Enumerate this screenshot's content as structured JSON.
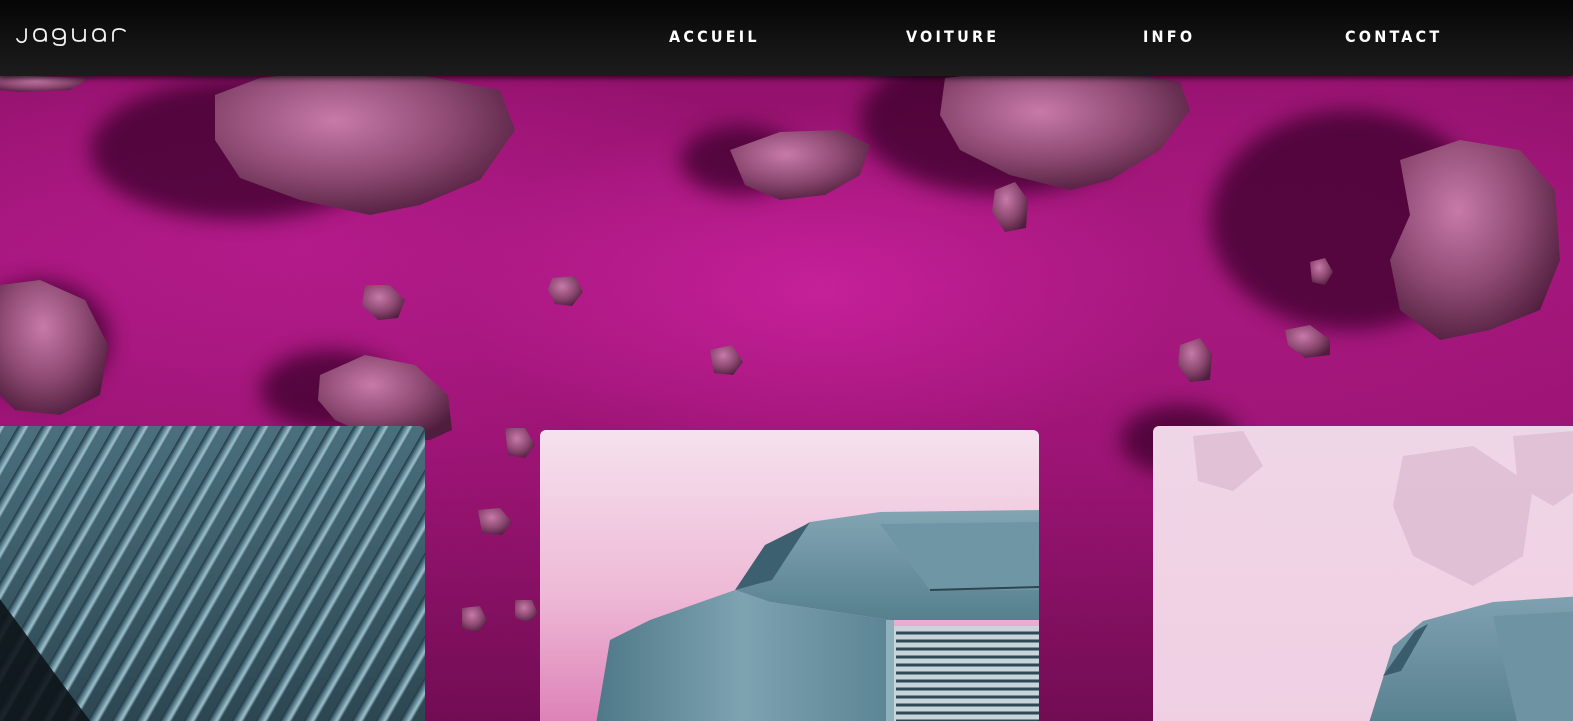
{
  "brand": {
    "logo_text": "JAGUAR"
  },
  "nav": {
    "items": [
      {
        "label": "ACCUEIL"
      },
      {
        "label": "VOITURE"
      },
      {
        "label": "INFO"
      },
      {
        "label": "CONTACT"
      }
    ]
  },
  "hero": {
    "background_color": "#a3157a",
    "image": "pink-rocky-desert"
  },
  "cards": [
    {
      "image": "car-grille-closeup-teal"
    },
    {
      "image": "teal-concept-car-front-pink-backdrop"
    },
    {
      "image": "teal-concept-car-front-pink-backdrop-faded"
    }
  ],
  "colors": {
    "navbar": "#121212",
    "nav_text": "#ffffff",
    "car_teal": "#5e8a9a",
    "card_backdrop": "#f2dce9"
  }
}
